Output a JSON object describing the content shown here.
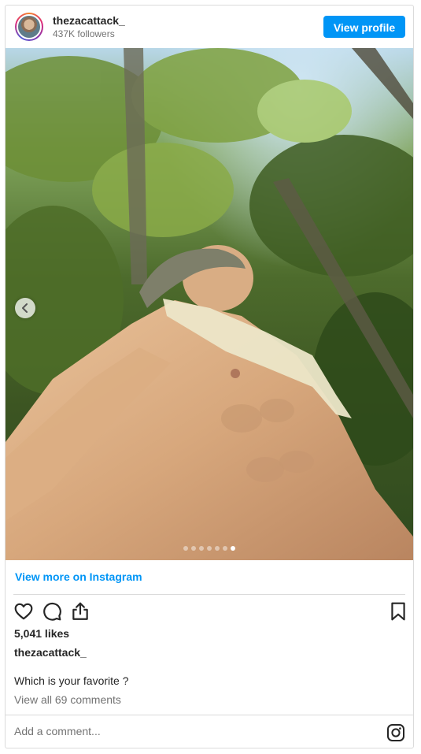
{
  "header": {
    "username": "thezacattack_",
    "followers": "437K followers",
    "view_profile_label": "View profile"
  },
  "media": {
    "carousel_count": 7,
    "active_index": 6
  },
  "footer": {
    "view_more_label": "View more on Instagram",
    "likes": "5,041 likes",
    "caption_username": "thezacattack_",
    "caption_text": "Which is your favorite ?",
    "view_comments_label": "View all 69 comments",
    "comment_placeholder": "Add a comment..."
  },
  "colors": {
    "accent": "#0095f6",
    "text": "#262626",
    "muted": "#737373",
    "border": "#dbdbdb"
  },
  "icons": [
    "heart-icon",
    "comment-icon",
    "share-icon",
    "bookmark-icon",
    "instagram-icon",
    "chevron-left-icon"
  ]
}
